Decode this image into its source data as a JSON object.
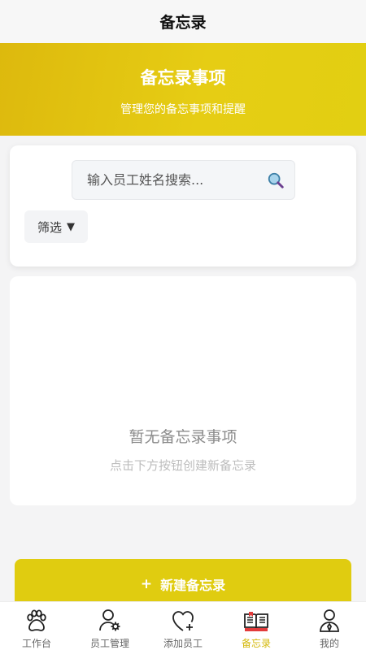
{
  "header": {
    "title": "备忘录"
  },
  "hero": {
    "title": "备忘录事项",
    "subtitle": "管理您的备忘事项和提醒"
  },
  "search": {
    "placeholder": "输入员工姓名搜索...",
    "value": "",
    "icon": "search-icon"
  },
  "filter": {
    "label": "筛选",
    "arrow": "▼"
  },
  "empty_state": {
    "title": "暂无备忘录事项",
    "hint": "点击下方按钮创建新备忘录"
  },
  "new_button": {
    "icon": "+",
    "label": "新建备忘录"
  },
  "tabbar": {
    "active_color": "#d4b80a",
    "items": [
      {
        "label": "工作台",
        "icon": "paw-icon"
      },
      {
        "label": "员工管理",
        "icon": "user-gear-icon"
      },
      {
        "label": "添加员工",
        "icon": "heart-plus-icon"
      },
      {
        "label": "备忘录",
        "icon": "book-icon",
        "active": true
      },
      {
        "label": "我的",
        "icon": "profile-icon"
      }
    ]
  }
}
